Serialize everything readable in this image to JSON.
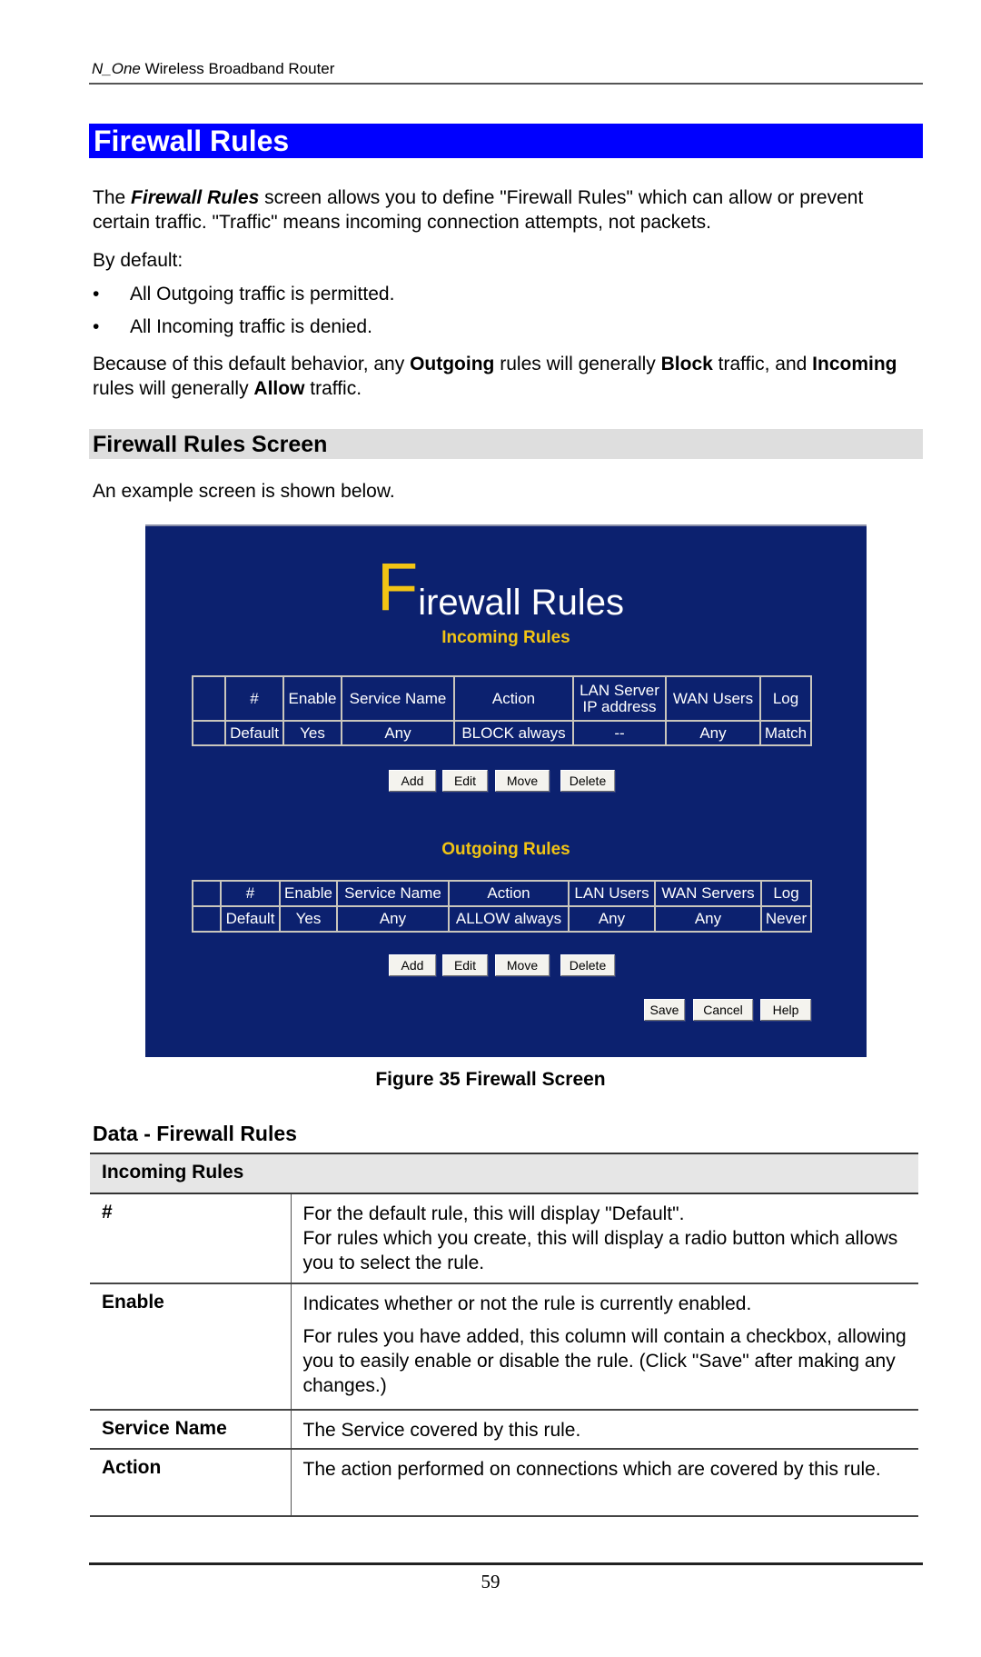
{
  "running_head": {
    "italic": "N_One",
    "rest": " Wireless Broadband Router"
  },
  "title": "Firewall Rules",
  "intro": {
    "prefix": "The ",
    "bold_italic": "Firewall Rules",
    "suffix": " screen allows you to define \"Firewall Rules\" which can allow or prevent certain traffic. \"Traffic\" means incoming connection attempts, not packets."
  },
  "by_default": "By default:",
  "bullets": [
    "All Outgoing traffic is permitted.",
    "All Incoming traffic is denied."
  ],
  "bullet_glyph": "•",
  "because": {
    "t1": "Because of this default behavior, any ",
    "b1": "Outgoing",
    "t2": " rules will generally ",
    "b2": "Block",
    "t3": " traffic, and ",
    "b3": "Incoming",
    "t4": " rules will generally ",
    "b4": "Allow",
    "t5": " traffic."
  },
  "section_title": "Firewall Rules Screen",
  "example_text": "An example screen is shown below.",
  "router_screen": {
    "title_initial": "F",
    "title_rest": "irewall Rules",
    "incoming": {
      "heading": "Incoming Rules",
      "headers": [
        "",
        "#",
        "Enable",
        "Service Name",
        "Action",
        "LAN Server IP address",
        "WAN Users",
        "Log"
      ],
      "header_lan_line1": "LAN Server",
      "header_lan_line2": "IP address",
      "rows": [
        [
          "",
          "Default",
          "Yes",
          "Any",
          "BLOCK always",
          "--",
          "Any",
          "Match"
        ]
      ]
    },
    "outgoing": {
      "heading": "Outgoing Rules",
      "headers": [
        "",
        "#",
        "Enable",
        "Service Name",
        "Action",
        "LAN Users",
        "WAN Servers",
        "Log"
      ],
      "rows": [
        [
          "",
          "Default",
          "Yes",
          "Any",
          "ALLOW always",
          "Any",
          "Any",
          "Never"
        ]
      ]
    },
    "rule_buttons": [
      "Add",
      "Edit",
      "Move",
      "Delete"
    ],
    "footer_buttons": [
      "Save",
      "Cancel",
      "Help"
    ],
    "colors": {
      "background": "#0c216f",
      "accent": "#f2c414",
      "text": "#ffffff"
    }
  },
  "figure_caption": "Figure 35 Firewall Screen",
  "data_heading": "Data - Firewall Rules",
  "data_table": {
    "section": "Incoming Rules",
    "rows": [
      {
        "key": "#",
        "paras": [
          "For the default rule, this will display \"Default\".\nFor rules which you create, this will display a radio button which allows you to select the rule."
        ]
      },
      {
        "key": "Enable",
        "paras": [
          "Indicates whether or not the rule is currently enabled.",
          "For rules you have added, this column will contain a checkbox, allowing you to easily enable or disable the rule. (Click \"Save\" after making any changes.)"
        ]
      },
      {
        "key": "Service Name",
        "paras": [
          "The Service covered by this rule."
        ]
      },
      {
        "key": "Action",
        "paras": [
          "The action performed on connections which are covered by this rule."
        ]
      }
    ]
  },
  "page_number": "59",
  "colors": {
    "title_bar": "#0000ff",
    "section_bar": "#dedede"
  }
}
